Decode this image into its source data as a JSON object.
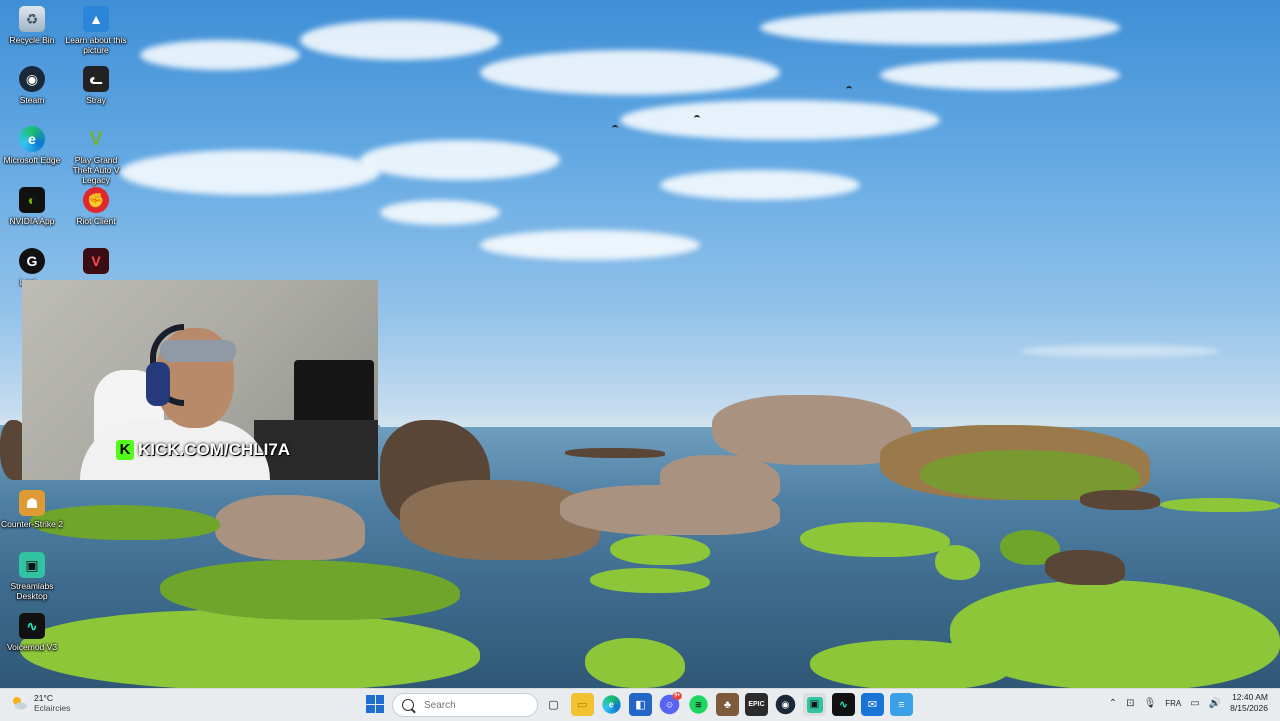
{
  "desktop": {
    "icons": [
      {
        "label": "Recycle Bin",
        "icon": "recycle-bin-icon"
      },
      {
        "label": "Learn about this picture",
        "icon": "picture-info-icon"
      },
      {
        "label": "Steam",
        "icon": "steam-icon"
      },
      {
        "label": "Stray",
        "icon": "stray-icon"
      },
      {
        "label": "Microsoft Edge",
        "icon": "edge-icon"
      },
      {
        "label": "Play Grand Theft Auto V Legacy",
        "icon": "gta-icon"
      },
      {
        "label": "NVIDIA App",
        "icon": "nvidia-icon"
      },
      {
        "label": "Riot Client",
        "icon": "riot-icon"
      },
      {
        "label": "Logi…",
        "icon": "logitech-icon"
      },
      {
        "label": "Counter-Strike 2",
        "icon": "counter-strike-icon"
      },
      {
        "label": "Streamlabs Desktop",
        "icon": "streamlabs-icon"
      },
      {
        "label": "Voicemod V3",
        "icon": "voicemod-icon"
      }
    ]
  },
  "webcam": {
    "overlay_text": "KICK.COM/CHLI7A",
    "logo_letter": "K"
  },
  "taskbar": {
    "weather": {
      "temp": "21°C",
      "condition": "Eclaircies"
    },
    "search_placeholder": "Search",
    "apps": [
      {
        "name": "task-view-icon",
        "active": false
      },
      {
        "name": "file-explorer-icon",
        "active": false
      },
      {
        "name": "edge-icon",
        "active": false
      },
      {
        "name": "store-icon",
        "active": false
      },
      {
        "name": "discord-icon",
        "active": false,
        "badge": "9+"
      },
      {
        "name": "spotify-icon",
        "active": false
      },
      {
        "name": "game-icon",
        "active": false
      },
      {
        "name": "epic-games-icon",
        "active": false
      },
      {
        "name": "steam-icon",
        "active": false
      },
      {
        "name": "streamlabs-icon",
        "active": true
      },
      {
        "name": "voicemod-icon",
        "active": false
      },
      {
        "name": "outlook-icon",
        "active": false
      },
      {
        "name": "notepad-icon",
        "active": false
      }
    ],
    "tray": {
      "language": "FRA",
      "time": "12:40 AM",
      "date": "8/15/2026"
    }
  },
  "colors": {
    "taskbar_bg": "#e9ecef",
    "kick_green": "#53fc18",
    "accent": "#1f6fd1"
  }
}
